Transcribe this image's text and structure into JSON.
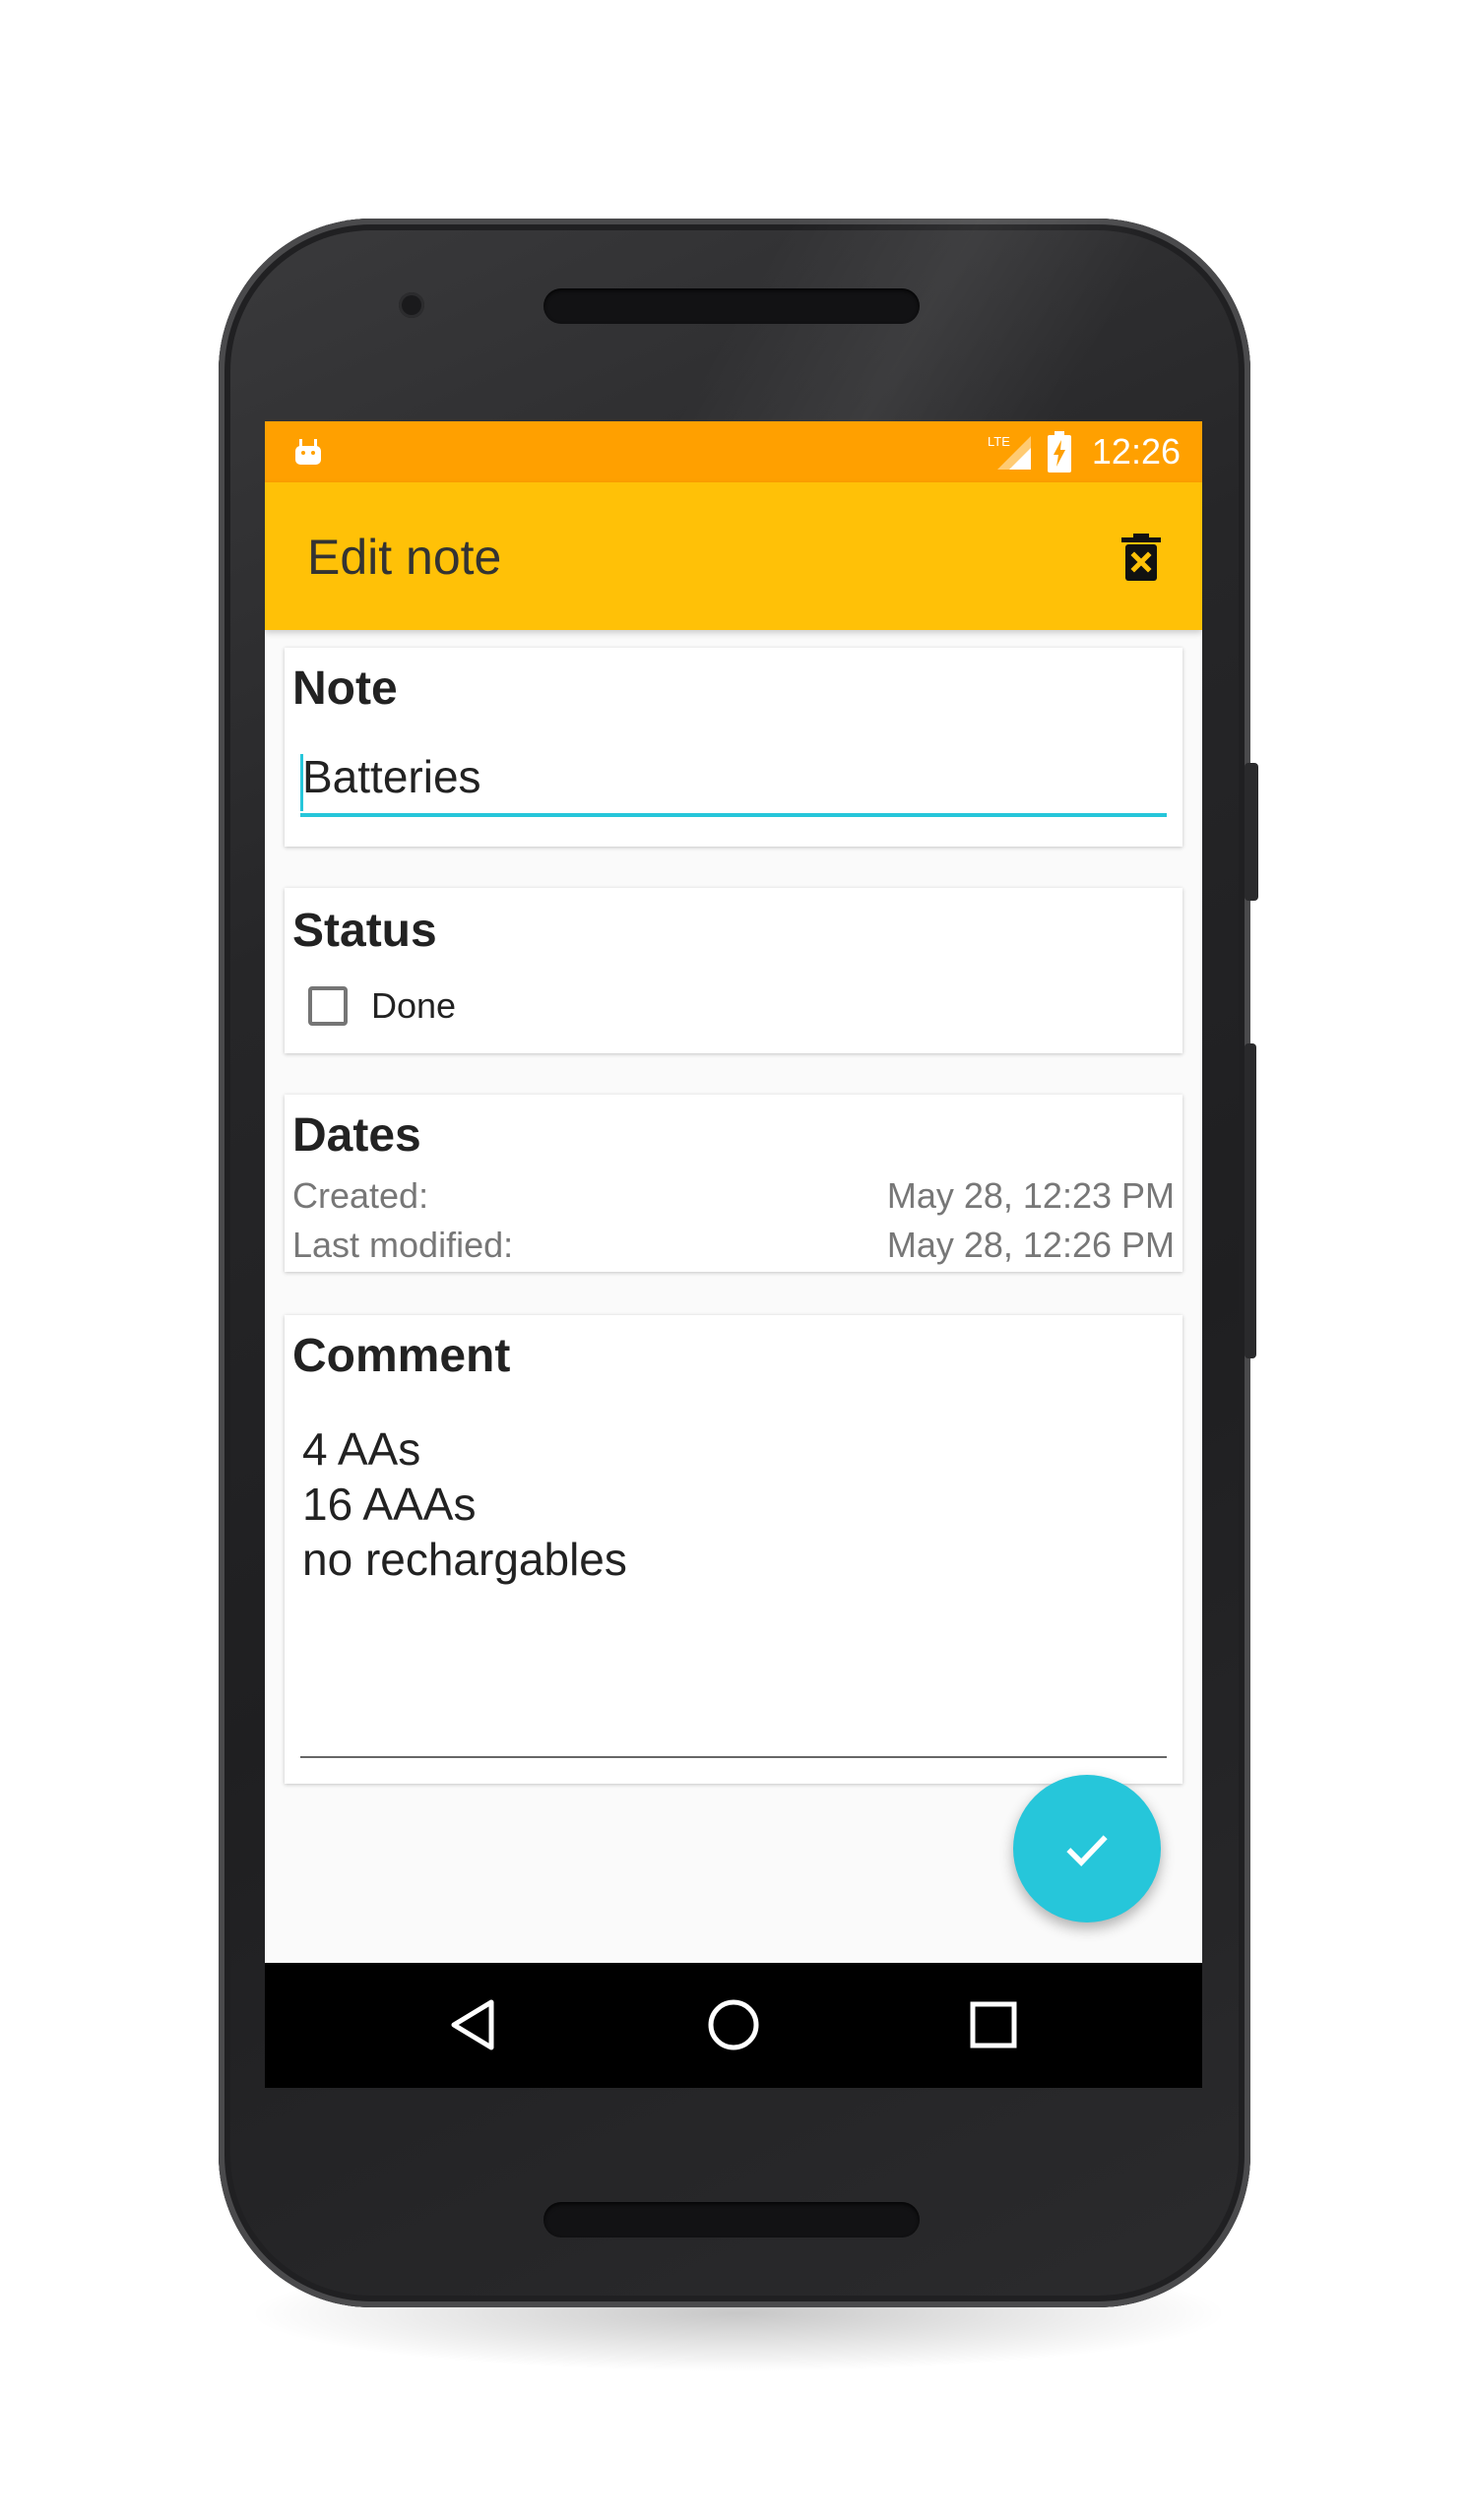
{
  "status_bar": {
    "network_label": "LTE",
    "time": "12:26",
    "left_icon": "android-debug-icon",
    "right_icons": [
      "lte-signal-icon",
      "battery-charging-icon"
    ]
  },
  "app_bar": {
    "title": "Edit note",
    "action_icon": "delete-icon"
  },
  "note_card": {
    "title": "Note",
    "value": "Batteries"
  },
  "status_card": {
    "title": "Status",
    "checkbox_label": "Done",
    "checked": false
  },
  "dates_card": {
    "title": "Dates",
    "created_label": "Created:",
    "created_value": "May 28, 12:23 PM",
    "modified_label": "Last modified:",
    "modified_value": "May 28, 12:26 PM"
  },
  "comment_card": {
    "title": "Comment",
    "lines": [
      "4 AAs",
      "16 AAAs",
      "no rechargables"
    ]
  },
  "fab": {
    "icon": "check-icon"
  },
  "nav_bar": {
    "icons": [
      "back-icon",
      "home-icon",
      "recents-icon"
    ]
  },
  "colors": {
    "status_bar": "#ffa000",
    "app_bar": "#ffc107",
    "accent": "#26c6da"
  }
}
